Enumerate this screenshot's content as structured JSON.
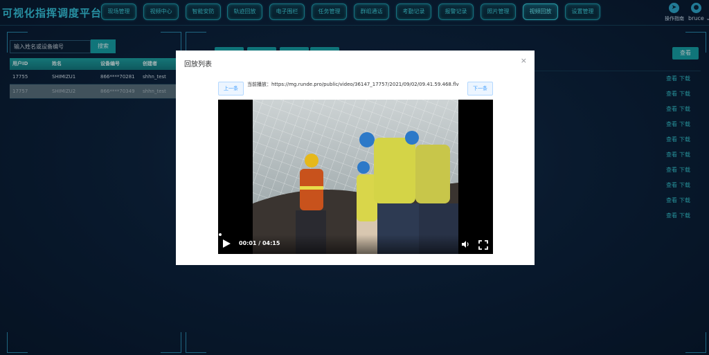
{
  "app": {
    "title": "可视化指挥调度平台"
  },
  "nav": {
    "items": [
      {
        "label": "现场管理"
      },
      {
        "label": "视频中心"
      },
      {
        "label": "智能安防"
      },
      {
        "label": "轨迹回放"
      },
      {
        "label": "电子围栏"
      },
      {
        "label": "任务管理"
      },
      {
        "label": "群组通话"
      },
      {
        "label": "考勤记录"
      },
      {
        "label": "报警记录"
      },
      {
        "label": "照片管理"
      },
      {
        "label": "视频回放"
      },
      {
        "label": "设置管理"
      }
    ],
    "active_index": 10
  },
  "header": {
    "guide_icon": "compass-icon",
    "guide_label": "操作指南",
    "user_icon": "user-icon",
    "user_name": "bruce",
    "user_chevron": "⌄"
  },
  "left": {
    "search_placeholder": "输入姓名或设备编号",
    "search_button": "搜索",
    "columns": [
      "用户ID",
      "姓名",
      "设备编号",
      "创建者"
    ],
    "rows": [
      [
        "17755",
        "SHIMIZU1",
        "866****70281",
        "shhn_test"
      ],
      [
        "17757",
        "SHIMIZU2",
        "866****70349",
        "shhn_test"
      ]
    ],
    "selected_row": 1
  },
  "right": {
    "view_button": "查看",
    "actions": [
      {
        "view": "查看",
        "download": "下载"
      },
      {
        "view": "查看",
        "download": "下载"
      },
      {
        "view": "查看",
        "download": "下载"
      },
      {
        "view": "查看",
        "download": "下载"
      },
      {
        "view": "查看",
        "download": "下载"
      },
      {
        "view": "查看",
        "download": "下载"
      },
      {
        "view": "查看",
        "download": "下载"
      },
      {
        "view": "查看",
        "download": "下载"
      },
      {
        "view": "查看",
        "download": "下载"
      },
      {
        "view": "查看",
        "download": "下载"
      }
    ]
  },
  "modal": {
    "title": "回放列表",
    "close": "×",
    "prev_button": "上一条",
    "next_button": "下一条",
    "now_playing": "当前播放：https://mg.runde.pro/public/video/36147_17757/2021/09/02/09.41.59.468.flv",
    "video": {
      "current_time": "00:01",
      "duration": "04:15",
      "time_display": "00:01 / 04:15",
      "progress_fraction": 0.004
    }
  },
  "colors": {
    "accent": "#17a3aa",
    "nav_text": "#3fd0dd",
    "link": "#35c6d2",
    "background": "#0d2440"
  }
}
